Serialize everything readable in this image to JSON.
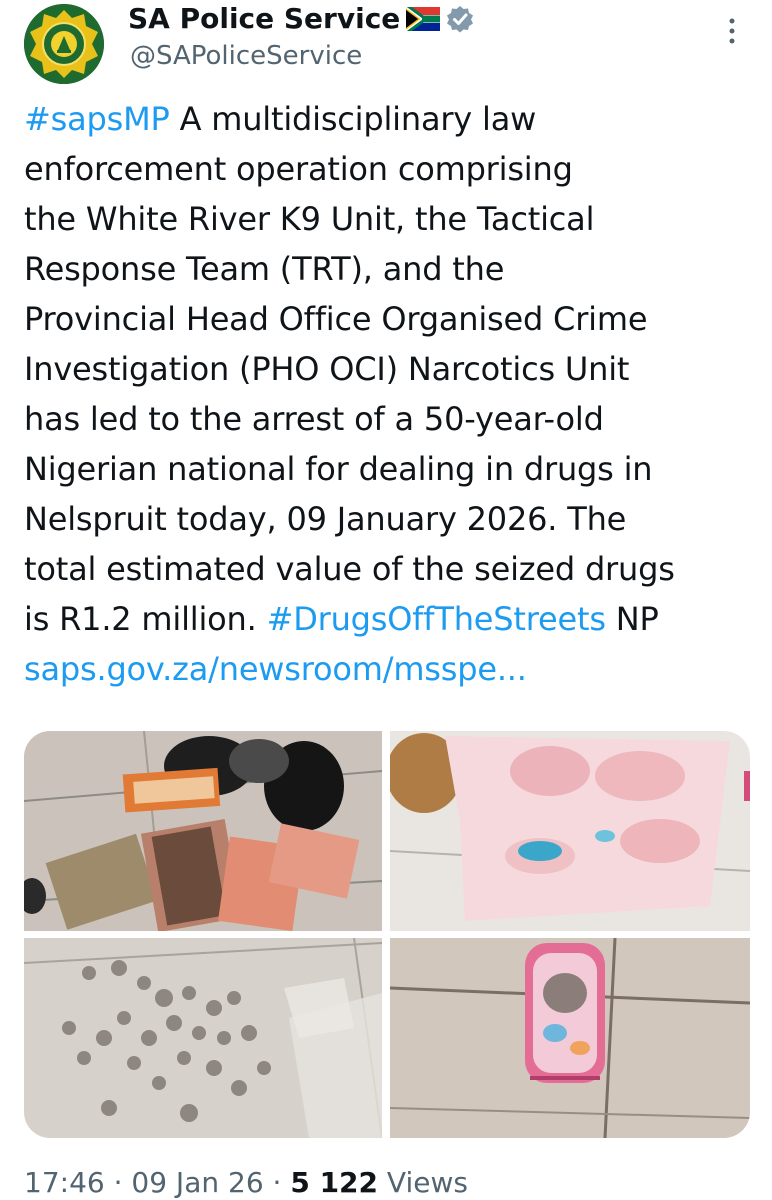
{
  "account": {
    "name": "SA Police Service",
    "handle": "@SAPoliceService",
    "avatar_icon": "saps-badge-logo",
    "flag_icon": "south-africa-flag-emoji",
    "verified_icon": "verified-gray-badge"
  },
  "more_icon": "vertical-ellipsis-icon",
  "tweet": {
    "lines": [
      {
        "hashtag": "#sapsMP",
        "text": " A multidisciplinary law"
      },
      {
        "text": "enforcement operation comprising"
      },
      {
        "text": "the White River K9 Unit, the Tactical"
      },
      {
        "text": "Response Team (TRT), and the"
      },
      {
        "text": "Provincial Head Office Organised Crime"
      },
      {
        "text": "Investigation (PHO OCI) Narcotics Unit"
      },
      {
        "text": "has led to the arrest of a 50-year-old"
      },
      {
        "text": "Nigerian national for dealing in drugs in"
      },
      {
        "text": "Nelspruit today, 09 January 2026. The"
      },
      {
        "text": "total estimated value of the seized drugs"
      },
      {
        "text": "is R1.2 million. ",
        "hashtag": "#DrugsOffTheStreets",
        "suffix": " NP"
      },
      {
        "link": "saps.gov.za/newsroom/msspe..."
      }
    ]
  },
  "media": [
    {
      "subject": "banknotes and black plastic bags on tiled floor"
    },
    {
      "subject": "brown package and stained pink paper"
    },
    {
      "subject": "grey drug pellets on tiles"
    },
    {
      "subject": "pink patterned bag on tiled floor"
    }
  ],
  "meta": {
    "time": "17:46",
    "sep1": " · ",
    "date": "09 Jan 26",
    "sep2": " · ",
    "views_count": "5 122",
    "views_label": " Views"
  },
  "colors": {
    "link": "#1d9bf0",
    "text": "#0f1419",
    "secondary": "#536471"
  }
}
